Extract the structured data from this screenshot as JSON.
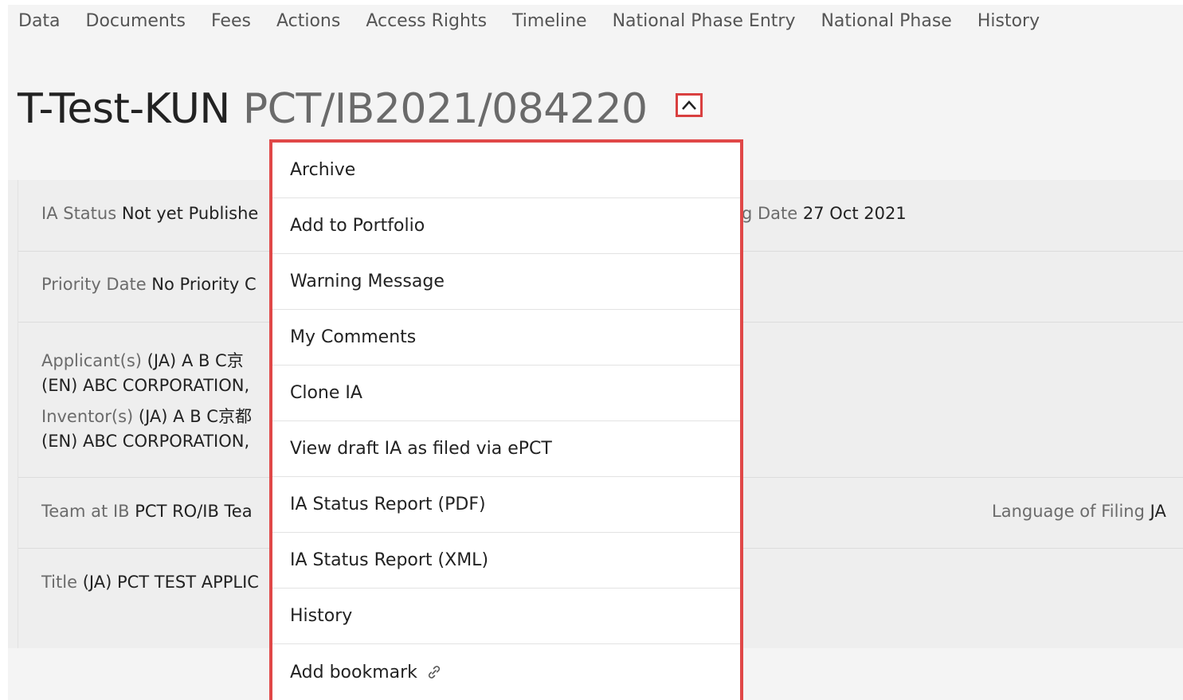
{
  "nav": {
    "items": [
      "Data",
      "Documents",
      "Fees",
      "Actions",
      "Access Rights",
      "Timeline",
      "National Phase Entry",
      "National Phase",
      "History"
    ]
  },
  "header": {
    "name": "T-Test-KUN",
    "number": "PCT/IB2021/084220",
    "toggle_icon": "chevron-up-icon"
  },
  "details": {
    "ia_status": {
      "label": "IA Status",
      "value": "Not yet Publishe"
    },
    "filing_date": {
      "label": "g Date",
      "value": "27 Oct 2021"
    },
    "priority_date": {
      "label": "Priority Date",
      "value": "No Priority C"
    },
    "applicants": {
      "label": "Applicant(s)",
      "ja": "(JA)",
      "ja_value": "A B C京",
      "en_value": "(EN) ABC CORPORATION,"
    },
    "inventors": {
      "label": "Inventor(s)",
      "ja": "(JA)",
      "ja_value": "A B C京都",
      "en_value": "(EN) ABC CORPORATION,"
    },
    "team": {
      "label": "Team at IB",
      "value": "PCT RO/IB Tea"
    },
    "language": {
      "label": "Language of Filing",
      "value": "JA"
    },
    "title": {
      "label": "Title",
      "value": "(JA) PCT TEST APPLIC"
    }
  },
  "menu": {
    "items": [
      "Archive",
      "Add to Portfolio",
      "Warning Message",
      "My Comments",
      "Clone IA",
      "View draft IA as filed via ePCT",
      "IA Status Report (PDF)",
      "IA Status Report (XML)",
      "History",
      "Add bookmark"
    ],
    "bookmark_icon": "link-icon"
  },
  "colors": {
    "highlight": "#e04848",
    "label": "#6b6b6b",
    "text": "#222222"
  }
}
